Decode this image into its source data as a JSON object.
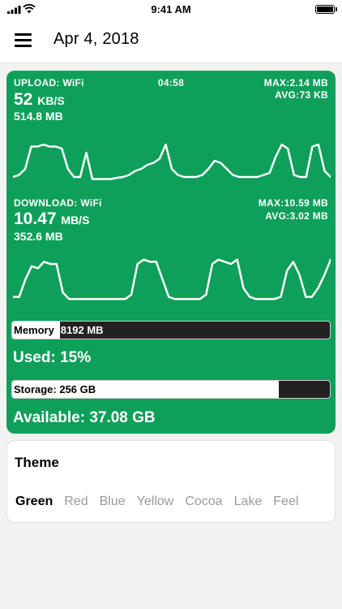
{
  "status_bar": {
    "time": "9:41 AM"
  },
  "nav": {
    "title": "Apr 4, 2018"
  },
  "upload": {
    "label": "UPLOAD: WiFi",
    "timer": "04:58",
    "max": "MAX:2.14 MB",
    "avg": "AVG:73 KB",
    "speed": "52",
    "unit": "KB/S",
    "total": "514.8 MB",
    "samples": [
      0.1,
      0.15,
      0.3,
      0.85,
      0.85,
      0.9,
      0.85,
      0.85,
      0.8,
      0.3,
      0.1,
      0.1,
      0.7,
      0.05,
      0.05,
      0.05,
      0.05,
      0.08,
      0.1,
      0.15,
      0.25,
      0.3,
      0.4,
      0.45,
      0.55,
      0.9,
      0.3,
      0.15,
      0.1,
      0.1,
      0.1,
      0.15,
      0.3,
      0.5,
      0.45,
      0.3,
      0.15,
      0.1,
      0.1,
      0.1,
      0.1,
      0.15,
      0.2,
      0.6,
      0.9,
      0.8,
      0.15,
      0.1,
      0.1,
      0.85,
      0.9,
      0.25,
      0.1
    ]
  },
  "download": {
    "label": "DOWNLOAD: WiFi",
    "max": "MAX:10.59 MB",
    "avg": "AVG:3.02 MB",
    "speed": "10.47",
    "unit": "MB/S",
    "total": "352.6 MB",
    "samples": [
      0.1,
      0.1,
      0.5,
      0.8,
      0.75,
      0.9,
      0.85,
      0.85,
      0.2,
      0.05,
      0.05,
      0.05,
      0.05,
      0.05,
      0.05,
      0.05,
      0.05,
      0.05,
      0.05,
      0.15,
      0.85,
      0.95,
      0.9,
      0.9,
      0.5,
      0.1,
      0.05,
      0.05,
      0.05,
      0.05,
      0.05,
      0.15,
      0.85,
      0.95,
      0.9,
      0.85,
      0.95,
      0.3,
      0.1,
      0.05,
      0.05,
      0.05,
      0.05,
      0.1,
      0.7,
      0.9,
      0.6,
      0.1,
      0.1,
      0.3,
      0.6,
      0.95
    ]
  },
  "memory": {
    "prefix": "Memory",
    "rest": ": 8192 MB",
    "used_fraction": 0.15
  },
  "used": {
    "text": "Used: 15%"
  },
  "storage": {
    "text": "Storage: 256 GB",
    "used_fraction": 0.84
  },
  "available": {
    "text": "Available: 37.08 GB"
  },
  "theme": {
    "title": "Theme",
    "options": [
      "Green",
      "Red",
      "Blue",
      "Yellow",
      "Cocoa",
      "Lake",
      "Feel"
    ],
    "selected": "Green"
  },
  "colors": {
    "accent": "#0e9f5a",
    "bar_empty": "#222222"
  }
}
